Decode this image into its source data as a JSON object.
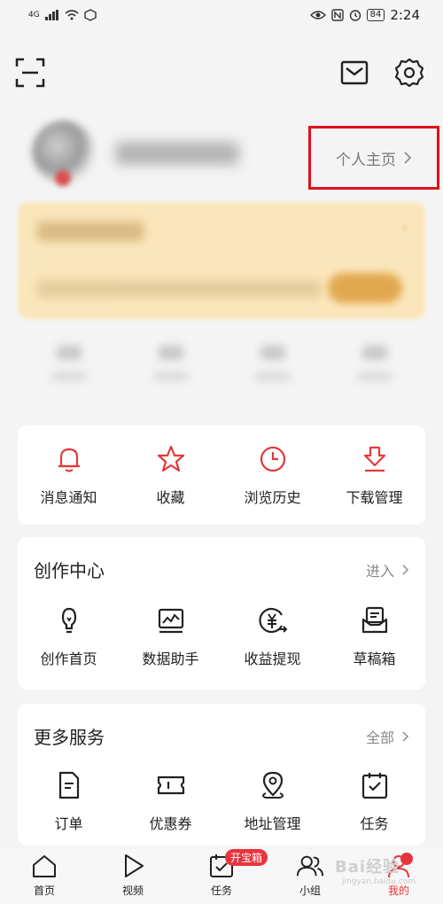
{
  "statusbar": {
    "network": "4G",
    "battery": "84",
    "time": "2:24"
  },
  "toolbar": {
    "scan_icon": "scan-icon",
    "mail_icon": "mail-icon",
    "settings_icon": "gear-icon"
  },
  "profile": {
    "homepage_label": "个人主页"
  },
  "quick": [
    {
      "label": "消息通知",
      "icon": "bell-icon"
    },
    {
      "label": "收藏",
      "icon": "star-icon"
    },
    {
      "label": "浏览历史",
      "icon": "clock-icon"
    },
    {
      "label": "下载管理",
      "icon": "download-icon"
    }
  ],
  "create": {
    "title": "创作中心",
    "action": "进入",
    "items": [
      {
        "label": "创作首页",
        "icon": "bulb-icon"
      },
      {
        "label": "数据助手",
        "icon": "chart-icon"
      },
      {
        "label": "收益提现",
        "icon": "yuan-icon"
      },
      {
        "label": "草稿箱",
        "icon": "draft-icon"
      }
    ]
  },
  "more": {
    "title": "更多服务",
    "action": "全部",
    "items": [
      {
        "label": "订单",
        "icon": "order-icon"
      },
      {
        "label": "优惠券",
        "icon": "coupon-icon"
      },
      {
        "label": "地址管理",
        "icon": "location-icon"
      },
      {
        "label": "任务",
        "icon": "task-icon"
      }
    ]
  },
  "nav": {
    "items": [
      {
        "label": "首页",
        "icon": "home-icon"
      },
      {
        "label": "视频",
        "icon": "play-icon"
      },
      {
        "label": "任务",
        "icon": "task-icon",
        "badge": "开宝箱"
      },
      {
        "label": "小组",
        "icon": "group-icon"
      },
      {
        "label": "我的",
        "icon": "profile-icon"
      }
    ]
  },
  "watermark": {
    "text": "Bai经验",
    "url": "jingyan.baidu.com"
  },
  "colors": {
    "accent": "#e33a3a",
    "badge": "#e8343f",
    "highlight_box": "#e0101a",
    "vip_bg": "#fbe6bb"
  }
}
